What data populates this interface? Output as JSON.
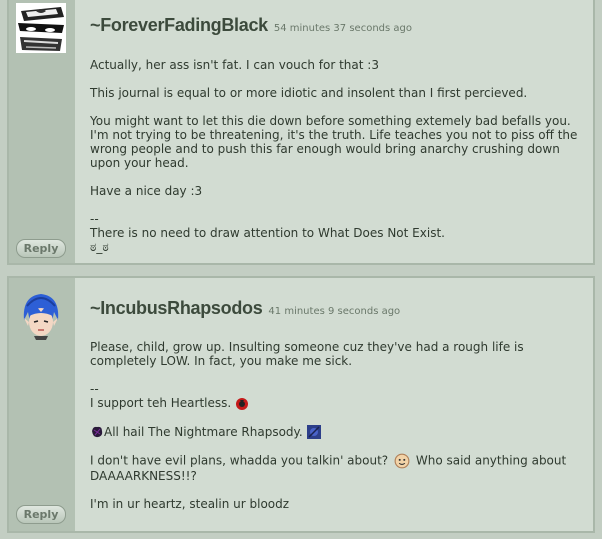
{
  "comments": [
    {
      "username": "~ForeverFadingBlack",
      "timestamp": "54 minutes 37 seconds ago",
      "reply_label": "Reply",
      "paragraphs": [
        "Actually, her ass isn't fat. I can vouch for that :3",
        "This journal is equal to or more idiotic and insolent than I first percieved.",
        "You might want to let this die down before something extemely bad befalls you. I'm not trying to be threatening, it's the truth. Life teaches you not to piss off the wrong people and to push this far enough would bring anarchy crushing down upon your head.",
        "Have a nice day :3"
      ],
      "sig_sep": "--",
      "sig_line1": "There is no need to draw attention to What Does Not Exist.",
      "sig_line2": "ಠ_ಠ"
    },
    {
      "username": "~IncubusRhapsodos",
      "timestamp": "41 minutes 9 seconds ago",
      "reply_label": "Reply",
      "para1": "Please, child, grow up. Insulting someone cuz they've had a rough life is completely LOW. In fact, you make me sick.",
      "sig_sep": "--",
      "sig_heartless": "I support teh Heartless.",
      "sig_nightmare": "All hail The Nightmare Rhapsody.",
      "sig_evil_a": "I don't have evil plans, whadda you talkin' about?",
      "sig_evil_b": "Who said anything about DAAAARKNESS!!?",
      "sig_heartz": "I'm in ur heartz, stealin ur bloodz"
    }
  ]
}
